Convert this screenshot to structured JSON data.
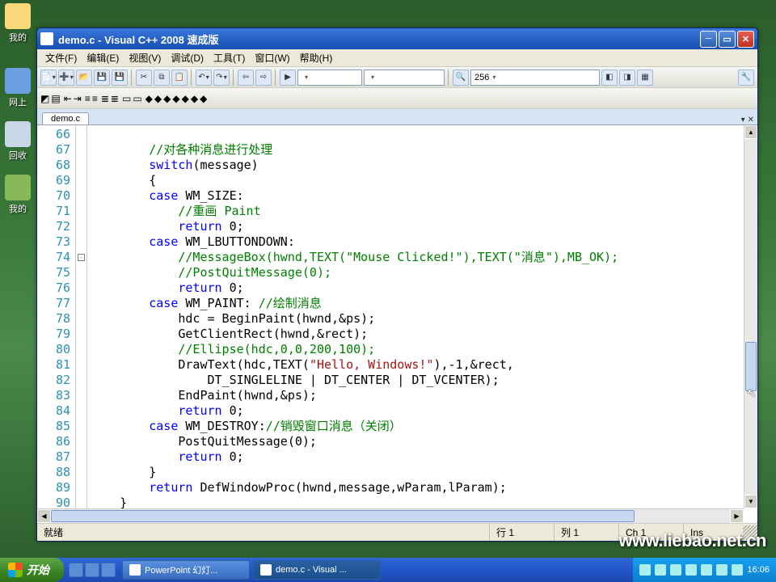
{
  "desktop": {
    "icon1": "我的",
    "icon2": "网上",
    "icon3": "回收",
    "icon4": "我的"
  },
  "window": {
    "title": "demo.c - Visual C++ 2008 速成版",
    "menus": [
      "文件(F)",
      "编辑(E)",
      "视图(V)",
      "调试(D)",
      "工具(T)",
      "窗口(W)",
      "帮助(H)"
    ],
    "combo_value": "256",
    "doc_tab": "demo.c"
  },
  "code": {
    "first_line": 66,
    "lines": [
      {
        "n": 66,
        "html": ""
      },
      {
        "n": 67,
        "html": "        <span class='cm'>//对各种消息进行处理</span>"
      },
      {
        "n": 68,
        "html": "        <span class='kw'>switch</span>(message)"
      },
      {
        "n": 69,
        "html": "        {"
      },
      {
        "n": 70,
        "html": "        <span class='kw'>case</span> WM_SIZE:"
      },
      {
        "n": 71,
        "html": "            <span class='cm'>//重画 Paint</span>"
      },
      {
        "n": 72,
        "html": "            <span class='kw'>return</span> 0;"
      },
      {
        "n": 73,
        "html": "        <span class='kw'>case</span> WM_LBUTTONDOWN:"
      },
      {
        "n": 74,
        "html": "            <span class='cm'>//MessageBox(hwnd,TEXT(\"Mouse Clicked!\"),TEXT(\"消息\"),MB_OK);</span>"
      },
      {
        "n": 75,
        "html": "            <span class='cm'>//PostQuitMessage(0);</span>"
      },
      {
        "n": 76,
        "html": "            <span class='kw'>return</span> 0;"
      },
      {
        "n": 77,
        "html": "        <span class='kw'>case</span> WM_PAINT: <span class='cm'>//绘制消息</span>"
      },
      {
        "n": 78,
        "html": "            hdc = BeginPaint(hwnd,&amp;ps);"
      },
      {
        "n": 79,
        "html": "            GetClientRect(hwnd,&amp;rect);"
      },
      {
        "n": 80,
        "html": "            <span class='cm'>//Ellipse(hdc,0,0,200,100);</span>"
      },
      {
        "n": 81,
        "html": "            DrawText(hdc,TEXT(<span class='str'>\"Hello, Windows!\"</span>),-1,&amp;rect,"
      },
      {
        "n": 82,
        "html": "                DT_SINGLELINE | DT_CENTER | DT_VCENTER);"
      },
      {
        "n": 83,
        "html": "            EndPaint(hwnd,&amp;ps);"
      },
      {
        "n": 84,
        "html": "            <span class='kw'>return</span> 0;"
      },
      {
        "n": 85,
        "html": "        <span class='kw'>case</span> WM_DESTROY:<span class='cm'>//销毁窗口消息（关闭）</span>"
      },
      {
        "n": 86,
        "html": "            PostQuitMessage(0);"
      },
      {
        "n": 87,
        "html": "            <span class='kw'>return</span> 0;"
      },
      {
        "n": 88,
        "html": "        }"
      },
      {
        "n": 89,
        "html": "        <span class='kw'>return</span> DefWindowProc(hwnd,message,wParam,lParam);"
      },
      {
        "n": 90,
        "html": "    }"
      }
    ]
  },
  "status": {
    "ready": "就绪",
    "line": "行 1",
    "col": "列 1",
    "ch": "Ch 1",
    "ins": "Ins"
  },
  "watermark": "www.liebao.net.cn",
  "taskbar": {
    "start": "开始",
    "buttons": [
      {
        "label": "PowerPoint 幻灯..."
      },
      {
        "label": "demo.c - Visual ..."
      }
    ],
    "clock": "16:06"
  }
}
